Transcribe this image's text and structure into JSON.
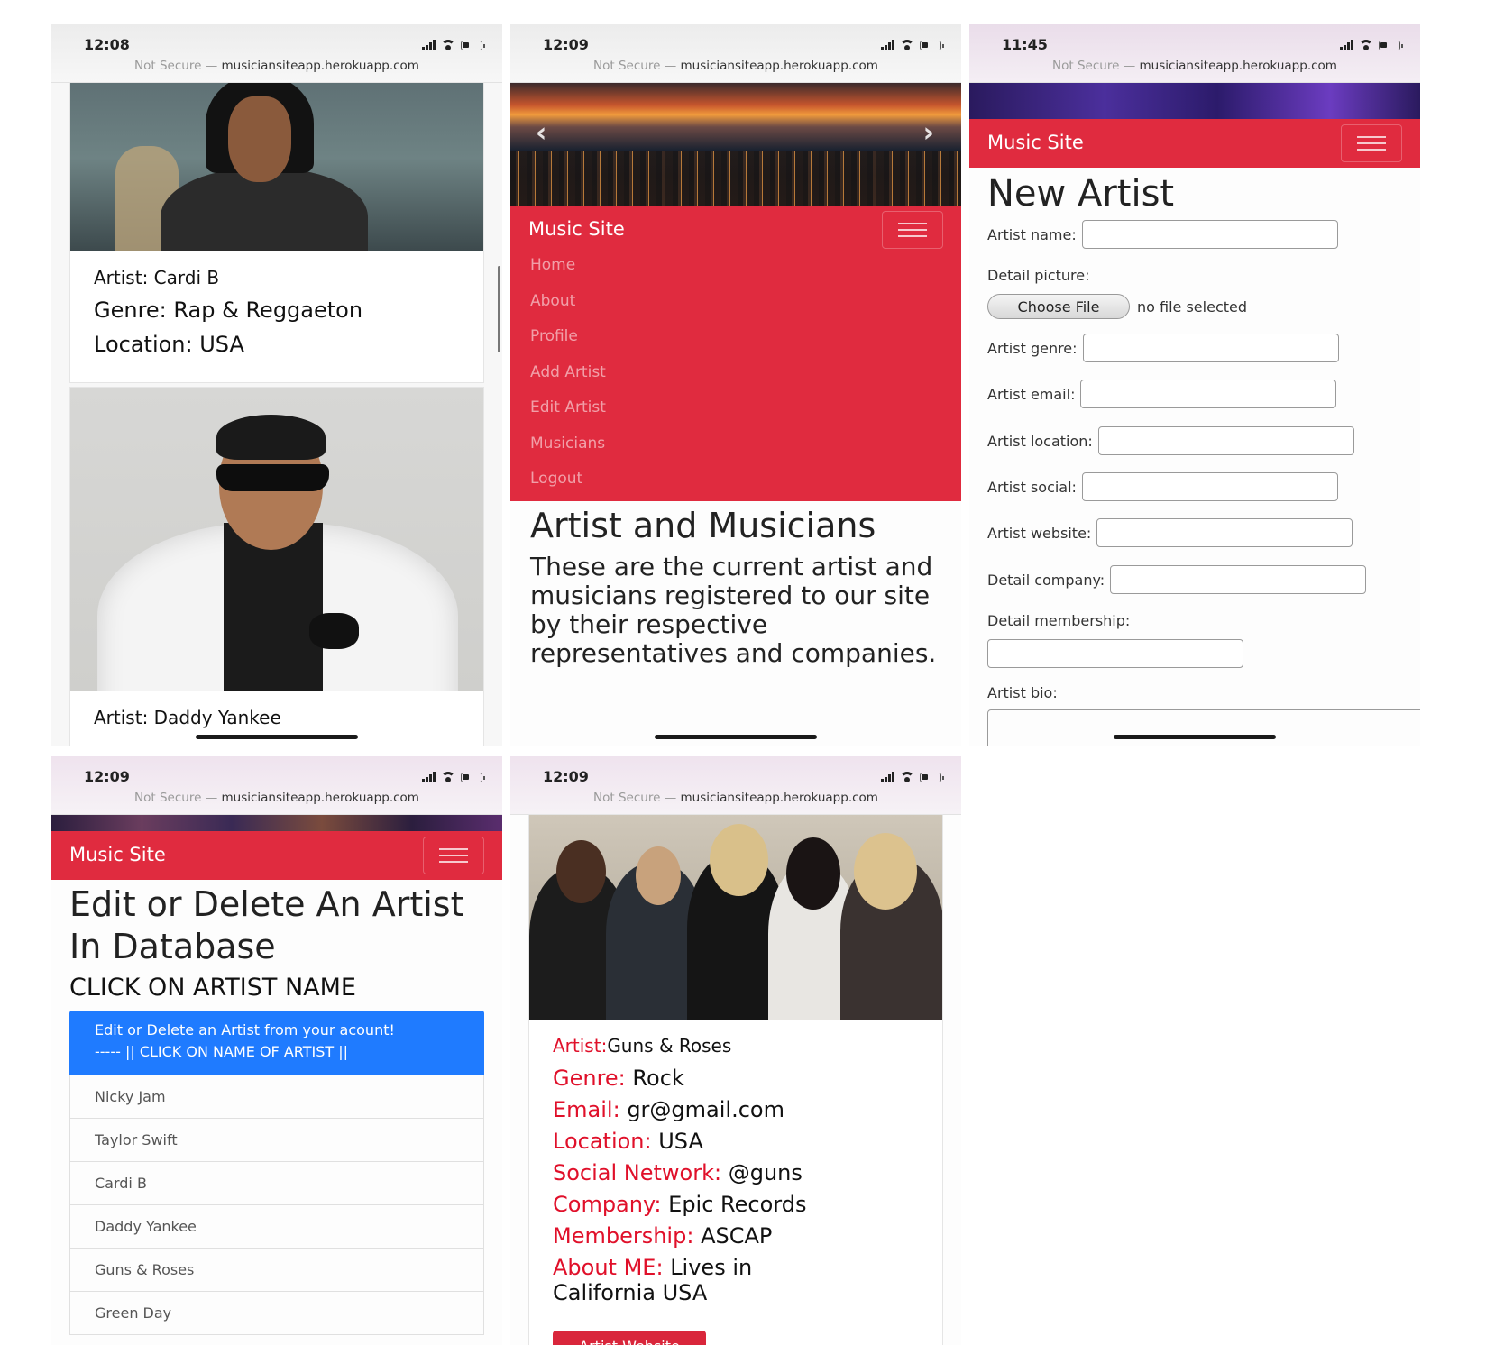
{
  "common": {
    "url_prefix": "Not Secure —",
    "url_domain": "musiciansiteapp.herokuapp.com",
    "brand": "Music Site",
    "colors": {
      "brand_red": "#e02b3f",
      "label_red": "#e0102a",
      "alert_blue": "#1f7bff"
    }
  },
  "screen1": {
    "time": "12:08",
    "cards": [
      {
        "artist": "Artist: Cardi B",
        "genre": "Genre: Rap & Reggaeton",
        "location": "Location: USA"
      },
      {
        "artist": "Artist: Daddy Yankee"
      }
    ]
  },
  "screen2": {
    "time": "12:09",
    "carousel_prev": "‹",
    "carousel_next": "›",
    "menu": [
      "Home",
      "About",
      "Profile",
      "Add Artist",
      "Edit Artist",
      "Musicians",
      "Logout"
    ],
    "heading": "Artist and Musicians",
    "description": "These are the current artist and musicians registered to our site by their respective representatives and companies."
  },
  "screen3": {
    "time": "11:45",
    "title": "New Artist",
    "labels": {
      "artist_name": "Artist name:",
      "detail_picture": "Detail picture:",
      "choose_file": "Choose File",
      "no_file": "no file selected",
      "artist_genre": "Artist genre:",
      "artist_email": "Artist email:",
      "artist_location": "Artist location:",
      "artist_social": "Artist social:",
      "artist_website": "Artist website:",
      "detail_company": "Detail company:",
      "detail_membership": "Detail membership:",
      "artist_bio": "Artist bio:"
    }
  },
  "screen4": {
    "time": "12:09",
    "title": "Edit or Delete An Artist In Database",
    "subtitle": "CLICK ON ARTIST NAME",
    "alert_line1": "Edit or Delete an Artist from your acount!",
    "alert_line2": "----- || CLICK ON NAME OF ARTIST ||",
    "artists": [
      "Nicky Jam",
      "Taylor Swift",
      "Cardi B",
      "Daddy Yankee",
      "Guns & Roses",
      "Green Day"
    ]
  },
  "screen5": {
    "time": "12:09",
    "artist_label": "Artist:",
    "artist_value": "Guns & Roses",
    "genre_label": "Genre:",
    "genre_value": "Rock",
    "email_label": "Email:",
    "email_value": "gr@gmail.com",
    "location_label": "Location:",
    "location_value": "USA",
    "social_label": "Social Network:",
    "social_value": "@guns",
    "company_label": "Company:",
    "company_value": "Epic Records",
    "membership_label": "Membership:",
    "membership_value": "ASCAP",
    "about_label": "About ME:",
    "about_value_1": "Lives in",
    "about_value_2": "California USA",
    "button": "Artist Website"
  }
}
